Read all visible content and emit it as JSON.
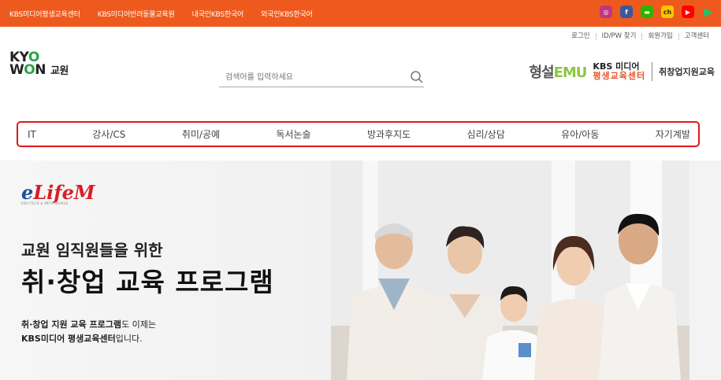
{
  "topbar": {
    "links": [
      "KBS미디어평생교육센터",
      "KBS미디어반려동물교육원",
      "내국인KBS한국어",
      "외국인KBS한국어"
    ],
    "sns": [
      {
        "name": "instagram-icon",
        "color": "#c13584",
        "glyph": "◎"
      },
      {
        "name": "facebook-icon",
        "color": "#3b5998",
        "glyph": "f"
      },
      {
        "name": "blog-icon",
        "color": "#2db400",
        "glyph": "▬"
      },
      {
        "name": "kakao-channel-icon",
        "color": "#f7c600",
        "glyph": "ch"
      },
      {
        "name": "youtube-icon",
        "color": "#ff0000",
        "glyph": "▶"
      },
      {
        "name": "play-icon",
        "color": "#1fc36a",
        "glyph": "▶"
      }
    ]
  },
  "util": {
    "login": "로그인",
    "find": "ID/PW 찾기",
    "join": "회원가입",
    "support": "고객센터"
  },
  "logo": {
    "line1": "KYO",
    "line2": "WON",
    "sub": "교원"
  },
  "search": {
    "placeholder": "검색어를 입력하세요"
  },
  "partners": {
    "p1_a": "형설",
    "p1_b": "EMU",
    "p2_a": "KBS 미디어",
    "p2_b": "평생교육센터",
    "p3": "취창업지원교육"
  },
  "nav": {
    "items": [
      "IT",
      "강사/CS",
      "취미/공예",
      "독서논술",
      "방과후지도",
      "심리/상담",
      "유아/아동",
      "자기계발"
    ]
  },
  "hero": {
    "brand": "LifeM",
    "brand_e": "e",
    "tag": "EDU-TECH & META-WORLD",
    "headline1": "교원 임직원들을 위한",
    "headline2": "취·창업 교육 프로그램",
    "desc_bold1": "취·창업 지원 교육 프로그램",
    "desc_1": "도 이제는",
    "desc_bold2": "KBS미디어 평생교육센터",
    "desc_2": "입니다."
  }
}
